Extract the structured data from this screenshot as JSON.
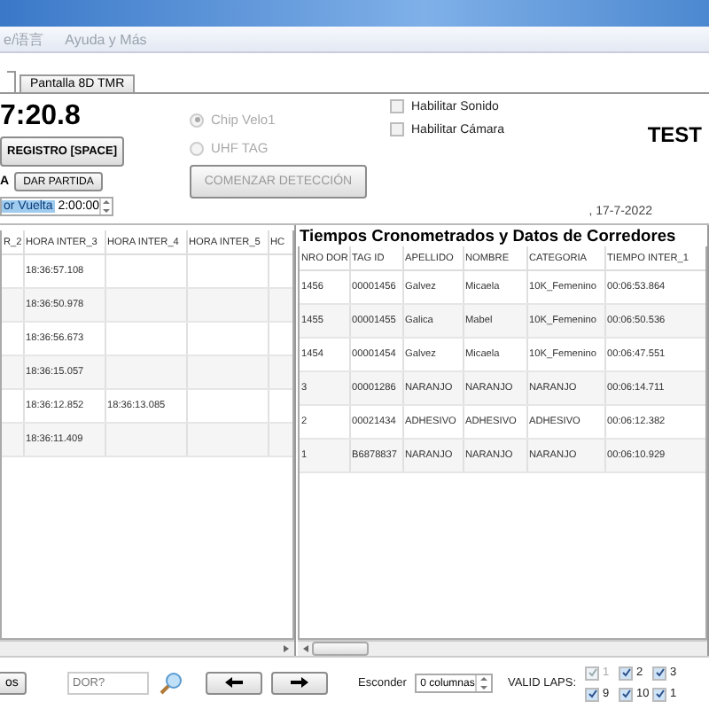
{
  "menu": [
    "e/语言",
    "Ayuda y Más"
  ],
  "tabs": [
    {
      "label": "Pantalla 8D TMR",
      "selected": false
    }
  ],
  "timer": "7:20.8",
  "register_button": "REGISTRO [SPACE]",
  "start_label": "A",
  "start_button": "DAR PARTIDA",
  "lap_label": "or Vuelta",
  "lap_value": "2:00:00",
  "radios": [
    {
      "label": "Chip Velo1",
      "selected": true
    },
    {
      "label": "UHF TAG",
      "selected": false
    }
  ],
  "detect_button": "COMENZAR DETECCIÓN",
  "checks": [
    {
      "label": "Habilitar Sonido",
      "checked": false
    },
    {
      "label": "Habilitar Cámara",
      "checked": false
    }
  ],
  "event_name": "TEST",
  "date": ", 17-7-2022",
  "left_table": {
    "columns": [
      "R_2",
      "HORA INTER_3",
      "HORA INTER_4",
      "HORA INTER_5",
      "HC"
    ],
    "rows": [
      [
        "",
        "18:36:57.108",
        "",
        "",
        ""
      ],
      [
        "",
        "18:36:50.978",
        "",
        "",
        ""
      ],
      [
        "",
        "18:36:56.673",
        "",
        "",
        ""
      ],
      [
        "",
        "18:36:15.057",
        "",
        "",
        ""
      ],
      [
        "",
        "18:36:12.852",
        "18:36:13.085",
        "",
        ""
      ],
      [
        "",
        "18:36:11.409",
        "",
        "",
        ""
      ]
    ]
  },
  "right_title": "Tiempos Cronometrados y Datos de Corredores",
  "right_table": {
    "columns": [
      "NRO DOR",
      "TAG ID",
      "APELLIDO",
      "NOMBRE",
      "CATEGORIA",
      "TIEMPO INTER_1"
    ],
    "rows": [
      [
        "1456",
        "00001456",
        "Galvez",
        "Micaela",
        "10K_Femenino",
        "00:06:53.864"
      ],
      [
        "1455",
        "00001455",
        "Galica",
        "Mabel",
        "10K_Femenino",
        "00:06:50.536"
      ],
      [
        "1454",
        "00001454",
        "Galvez",
        "Micaela",
        "10K_Femenino",
        "00:06:47.551"
      ],
      [
        "3",
        "00001286",
        "NARANJO",
        "NARANJO",
        "NARANJO",
        "00:06:14.711"
      ],
      [
        "2",
        "00021434",
        "ADHESIVO",
        "ADHESIVO",
        "ADHESIVO",
        "00:06:12.382"
      ],
      [
        "1",
        "B6878837",
        "NARANJO",
        "NARANJO",
        "NARANJO",
        "00:06:10.929"
      ]
    ]
  },
  "bottom_button": "os",
  "search": {
    "placeholder": "DOR?"
  },
  "hide_label": "Esconder",
  "hide_value": "0 columnas",
  "laps_label": "VALID LAPS:",
  "laps": [
    {
      "label": "1",
      "checked": true,
      "disabled": true
    },
    {
      "label": "2",
      "checked": true,
      "disabled": false
    },
    {
      "label": "3",
      "checked": true,
      "disabled": false
    },
    {
      "label": "9",
      "checked": true,
      "disabled": false
    },
    {
      "label": "10",
      "checked": true,
      "disabled": false
    },
    {
      "label": "1",
      "checked": true,
      "disabled": false
    }
  ]
}
